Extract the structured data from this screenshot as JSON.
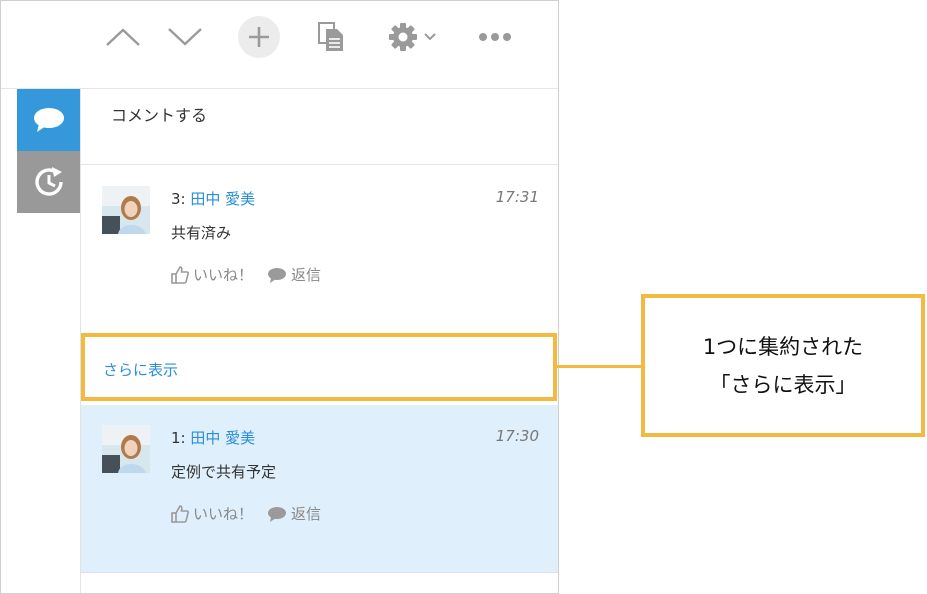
{
  "toolbar": {
    "icons": [
      "chevron-up-icon",
      "chevron-down-icon",
      "plus-icon",
      "document-icon",
      "gear-icon",
      "more-icon"
    ]
  },
  "sidebar": {
    "tabs": [
      {
        "icon": "comment-icon",
        "active": true
      },
      {
        "icon": "history-icon",
        "active": false
      }
    ]
  },
  "comment_box": {
    "placeholder": "コメントする"
  },
  "posts": [
    {
      "number": "3:",
      "author": "田中 愛美",
      "time": "17:31",
      "body": "共有済み",
      "like_label": "いいね！",
      "reply_label": "返信"
    },
    {
      "number": "1:",
      "author": "田中 愛美",
      "time": "17:30",
      "body": "定例で共有予定",
      "like_label": "いいね！",
      "reply_label": "返信"
    }
  ],
  "show_more": {
    "label": "さらに表示"
  },
  "annotation": {
    "line1": "1つに集約された",
    "line2": "「さらに表示」"
  },
  "colors": {
    "accent": "#3498db",
    "link": "#2a8fd8",
    "highlight": "#f4b941",
    "selected_post_bg": "#dff0fc"
  }
}
